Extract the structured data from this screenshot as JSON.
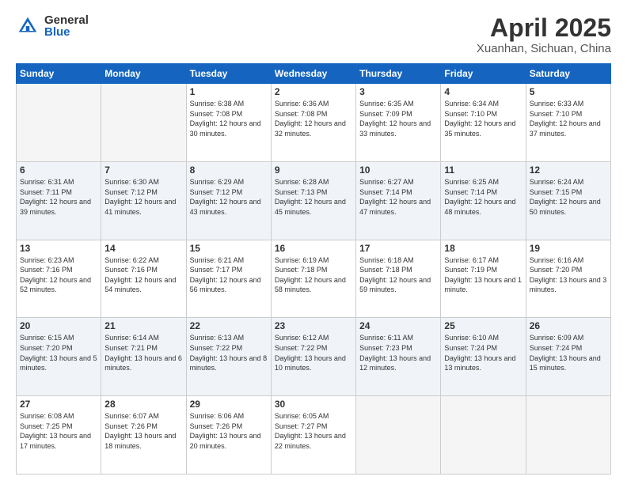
{
  "header": {
    "logo_general": "General",
    "logo_blue": "Blue",
    "month_title": "April 2025",
    "location": "Xuanhan, Sichuan, China"
  },
  "weekdays": [
    "Sunday",
    "Monday",
    "Tuesday",
    "Wednesday",
    "Thursday",
    "Friday",
    "Saturday"
  ],
  "weeks": [
    [
      {
        "day": "",
        "info": ""
      },
      {
        "day": "",
        "info": ""
      },
      {
        "day": "1",
        "info": "Sunrise: 6:38 AM\nSunset: 7:08 PM\nDaylight: 12 hours\nand 30 minutes."
      },
      {
        "day": "2",
        "info": "Sunrise: 6:36 AM\nSunset: 7:08 PM\nDaylight: 12 hours\nand 32 minutes."
      },
      {
        "day": "3",
        "info": "Sunrise: 6:35 AM\nSunset: 7:09 PM\nDaylight: 12 hours\nand 33 minutes."
      },
      {
        "day": "4",
        "info": "Sunrise: 6:34 AM\nSunset: 7:10 PM\nDaylight: 12 hours\nand 35 minutes."
      },
      {
        "day": "5",
        "info": "Sunrise: 6:33 AM\nSunset: 7:10 PM\nDaylight: 12 hours\nand 37 minutes."
      }
    ],
    [
      {
        "day": "6",
        "info": "Sunrise: 6:31 AM\nSunset: 7:11 PM\nDaylight: 12 hours\nand 39 minutes."
      },
      {
        "day": "7",
        "info": "Sunrise: 6:30 AM\nSunset: 7:12 PM\nDaylight: 12 hours\nand 41 minutes."
      },
      {
        "day": "8",
        "info": "Sunrise: 6:29 AM\nSunset: 7:12 PM\nDaylight: 12 hours\nand 43 minutes."
      },
      {
        "day": "9",
        "info": "Sunrise: 6:28 AM\nSunset: 7:13 PM\nDaylight: 12 hours\nand 45 minutes."
      },
      {
        "day": "10",
        "info": "Sunrise: 6:27 AM\nSunset: 7:14 PM\nDaylight: 12 hours\nand 47 minutes."
      },
      {
        "day": "11",
        "info": "Sunrise: 6:25 AM\nSunset: 7:14 PM\nDaylight: 12 hours\nand 48 minutes."
      },
      {
        "day": "12",
        "info": "Sunrise: 6:24 AM\nSunset: 7:15 PM\nDaylight: 12 hours\nand 50 minutes."
      }
    ],
    [
      {
        "day": "13",
        "info": "Sunrise: 6:23 AM\nSunset: 7:16 PM\nDaylight: 12 hours\nand 52 minutes."
      },
      {
        "day": "14",
        "info": "Sunrise: 6:22 AM\nSunset: 7:16 PM\nDaylight: 12 hours\nand 54 minutes."
      },
      {
        "day": "15",
        "info": "Sunrise: 6:21 AM\nSunset: 7:17 PM\nDaylight: 12 hours\nand 56 minutes."
      },
      {
        "day": "16",
        "info": "Sunrise: 6:19 AM\nSunset: 7:18 PM\nDaylight: 12 hours\nand 58 minutes."
      },
      {
        "day": "17",
        "info": "Sunrise: 6:18 AM\nSunset: 7:18 PM\nDaylight: 12 hours\nand 59 minutes."
      },
      {
        "day": "18",
        "info": "Sunrise: 6:17 AM\nSunset: 7:19 PM\nDaylight: 13 hours\nand 1 minute."
      },
      {
        "day": "19",
        "info": "Sunrise: 6:16 AM\nSunset: 7:20 PM\nDaylight: 13 hours\nand 3 minutes."
      }
    ],
    [
      {
        "day": "20",
        "info": "Sunrise: 6:15 AM\nSunset: 7:20 PM\nDaylight: 13 hours\nand 5 minutes."
      },
      {
        "day": "21",
        "info": "Sunrise: 6:14 AM\nSunset: 7:21 PM\nDaylight: 13 hours\nand 6 minutes."
      },
      {
        "day": "22",
        "info": "Sunrise: 6:13 AM\nSunset: 7:22 PM\nDaylight: 13 hours\nand 8 minutes."
      },
      {
        "day": "23",
        "info": "Sunrise: 6:12 AM\nSunset: 7:22 PM\nDaylight: 13 hours\nand 10 minutes."
      },
      {
        "day": "24",
        "info": "Sunrise: 6:11 AM\nSunset: 7:23 PM\nDaylight: 13 hours\nand 12 minutes."
      },
      {
        "day": "25",
        "info": "Sunrise: 6:10 AM\nSunset: 7:24 PM\nDaylight: 13 hours\nand 13 minutes."
      },
      {
        "day": "26",
        "info": "Sunrise: 6:09 AM\nSunset: 7:24 PM\nDaylight: 13 hours\nand 15 minutes."
      }
    ],
    [
      {
        "day": "27",
        "info": "Sunrise: 6:08 AM\nSunset: 7:25 PM\nDaylight: 13 hours\nand 17 minutes."
      },
      {
        "day": "28",
        "info": "Sunrise: 6:07 AM\nSunset: 7:26 PM\nDaylight: 13 hours\nand 18 minutes."
      },
      {
        "day": "29",
        "info": "Sunrise: 6:06 AM\nSunset: 7:26 PM\nDaylight: 13 hours\nand 20 minutes."
      },
      {
        "day": "30",
        "info": "Sunrise: 6:05 AM\nSunset: 7:27 PM\nDaylight: 13 hours\nand 22 minutes."
      },
      {
        "day": "",
        "info": ""
      },
      {
        "day": "",
        "info": ""
      },
      {
        "day": "",
        "info": ""
      }
    ]
  ]
}
